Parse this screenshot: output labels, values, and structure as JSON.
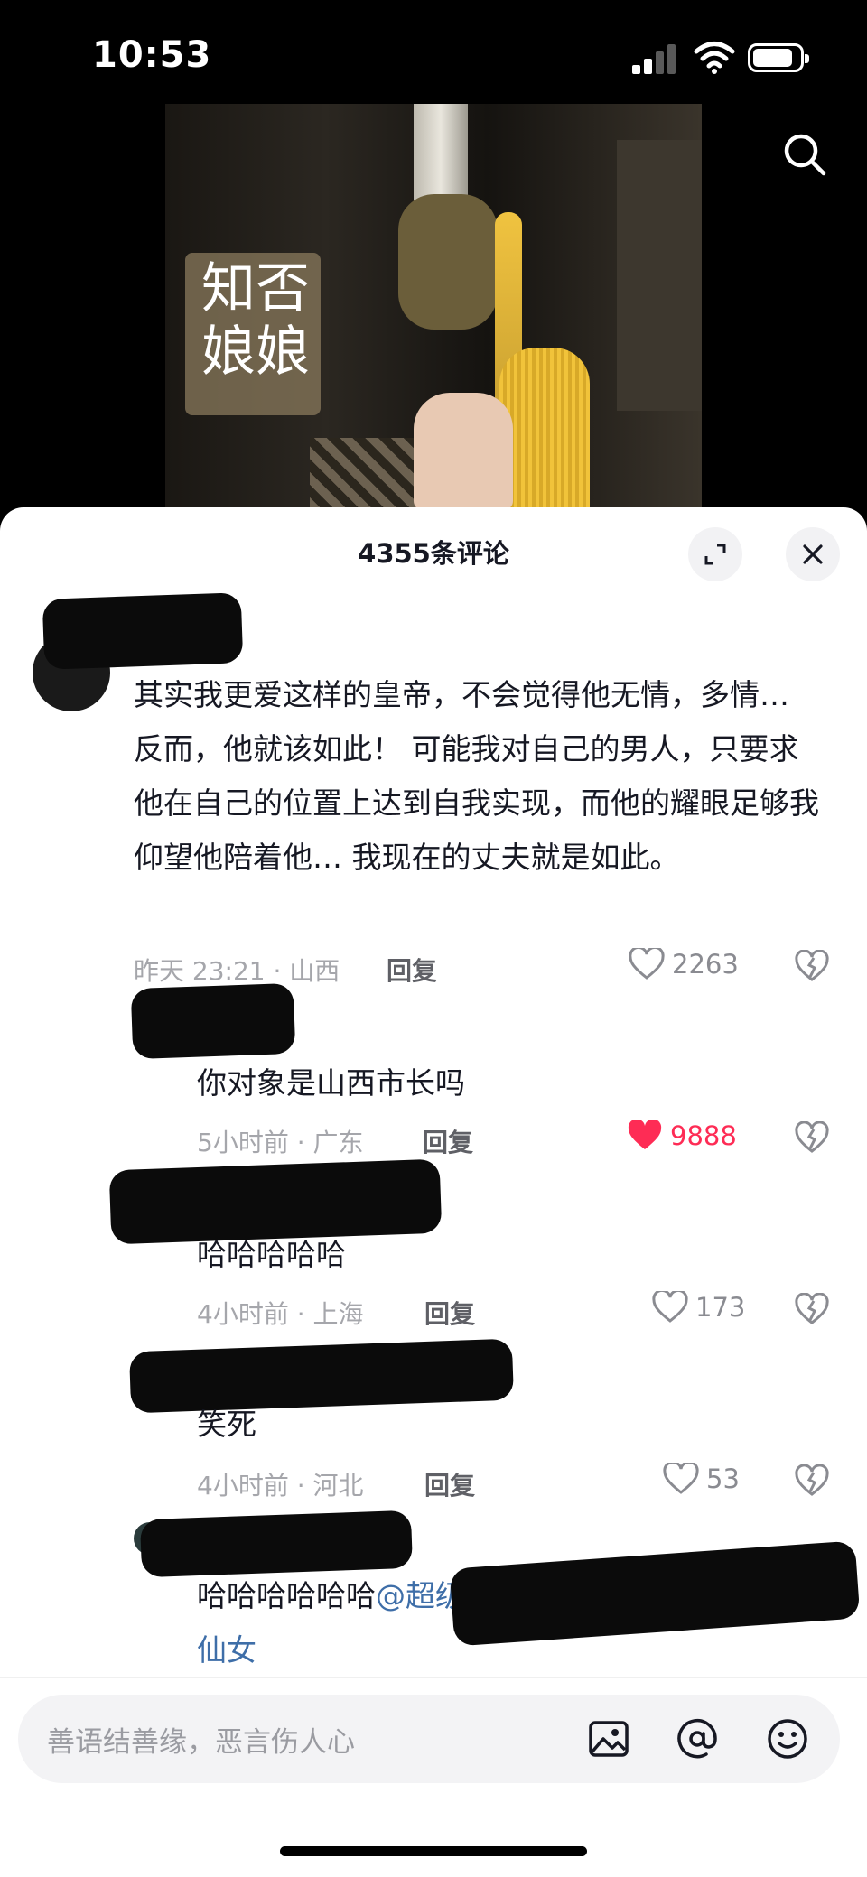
{
  "status_bar": {
    "time": "10:53"
  },
  "comments_panel": {
    "title": "4355条评论"
  },
  "comments": [
    {
      "text": "其实我更爱这样的皇帝，不会觉得他无情，多情… 反而，他就该如此！ 可能我对自己的男人，只要求他在自己的位置上达到自我实现，而他的耀眼足够我仰望他陪着他… 我现在的丈夫就是如此。",
      "meta": "昨天 23:21 · 山西",
      "reply": "回复",
      "likes": "2263",
      "liked": false
    },
    {
      "text": "你对象是山西市长吗",
      "meta": "5小时前 · 广东",
      "reply": "回复",
      "likes": "9888",
      "liked": true
    },
    {
      "text": "哈哈哈哈哈",
      "meta": "4小时前 · 上海",
      "reply": "回复",
      "likes": "173",
      "liked": false
    },
    {
      "text": "笑死",
      "meta": "4小时前 · 河北",
      "reply": "回复",
      "likes": "53",
      "liked": false
    },
    {
      "text": "哈哈哈哈哈哈",
      "mention": "@超级",
      "mention_tail": "仙女"
    }
  ],
  "input": {
    "placeholder": "善语结善缘，恶言伤人心"
  },
  "colors": {
    "like_active": "#fe2c55",
    "mention": "#3e6ea8"
  }
}
